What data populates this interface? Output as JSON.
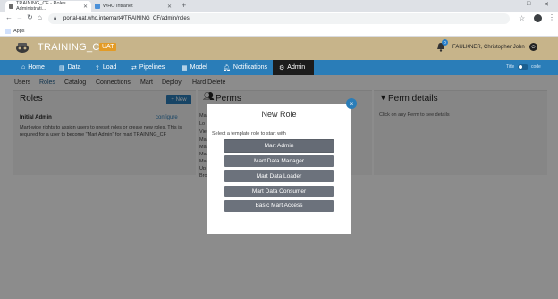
{
  "browser": {
    "tabs": [
      {
        "title": "TRAINING_CF - Roles Administrati...",
        "favicon_color": "#6b6b6b"
      },
      {
        "title": "WHO Intranet",
        "favicon_color": "#4a90d9"
      }
    ],
    "new_tab": "+",
    "window_controls": [
      "–",
      "□",
      "✕"
    ],
    "url": "portal-uat.who.int/emart4/TRAINING_CF/admin/roles",
    "bookmarks": [
      {
        "label": "Apps"
      }
    ],
    "icons": [
      "back-icon",
      "forward-icon",
      "reload-icon",
      "home-icon",
      "lock-icon",
      "star-icon",
      "profile-icon",
      "menu-kebab-icon"
    ]
  },
  "app": {
    "title": "TRAINING_CF",
    "env_badge": "UAT",
    "notification_count": "0",
    "user_name": "FAULKNER, Christopher John",
    "user_menu_icon": "⏻",
    "colors": {
      "header": "#c7b48a",
      "nav": "#2a7db8",
      "badge": "#e39b26",
      "active_nav": "#1c1c1c"
    }
  },
  "main_nav": {
    "items": [
      {
        "label": "Home",
        "icon": "home-icon"
      },
      {
        "label": "Data",
        "icon": "data-icon"
      },
      {
        "label": "Load",
        "icon": "load-icon"
      },
      {
        "label": "Pipelines",
        "icon": "pipelines-icon"
      },
      {
        "label": "Model",
        "icon": "model-icon"
      },
      {
        "label": "Notifications",
        "icon": "bell-icon"
      },
      {
        "label": "Admin",
        "icon": "gear-icon"
      }
    ],
    "active": "Admin",
    "toggle_label": "Title",
    "toggle_state": "code"
  },
  "sub_nav": {
    "items": [
      "Users",
      "Roles",
      "Catalog",
      "Connections",
      "Mart",
      "Deploy",
      "Hard Delete"
    ],
    "active": "Roles"
  },
  "roles_panel": {
    "title": "Roles",
    "new_button": "+ New",
    "role": {
      "name": "Initial Admin",
      "configure": "configure",
      "description": "Mart-wide rights to assign users to preset roles or create new roles. This is required for a user to become \"Mart Admin\" for mart TRAINING_CF"
    }
  },
  "perms_panel": {
    "title": "Perms",
    "partial_rows": [
      "Ma",
      "Lo",
      "Vie",
      "Ma",
      "Ma",
      "Ma",
      "Ma",
      "Up",
      "Bro"
    ]
  },
  "perm_details_panel": {
    "title": "Perm details",
    "hint": "Click on any Perm to see details"
  },
  "modal": {
    "title": "New Role",
    "close": "×",
    "prompt": "Select a template role to start with",
    "templates": [
      "Mart Admin",
      "Mart Data Manager",
      "Mart Data Loader",
      "Mart Data Consumer",
      "Basic Mart Access"
    ]
  }
}
